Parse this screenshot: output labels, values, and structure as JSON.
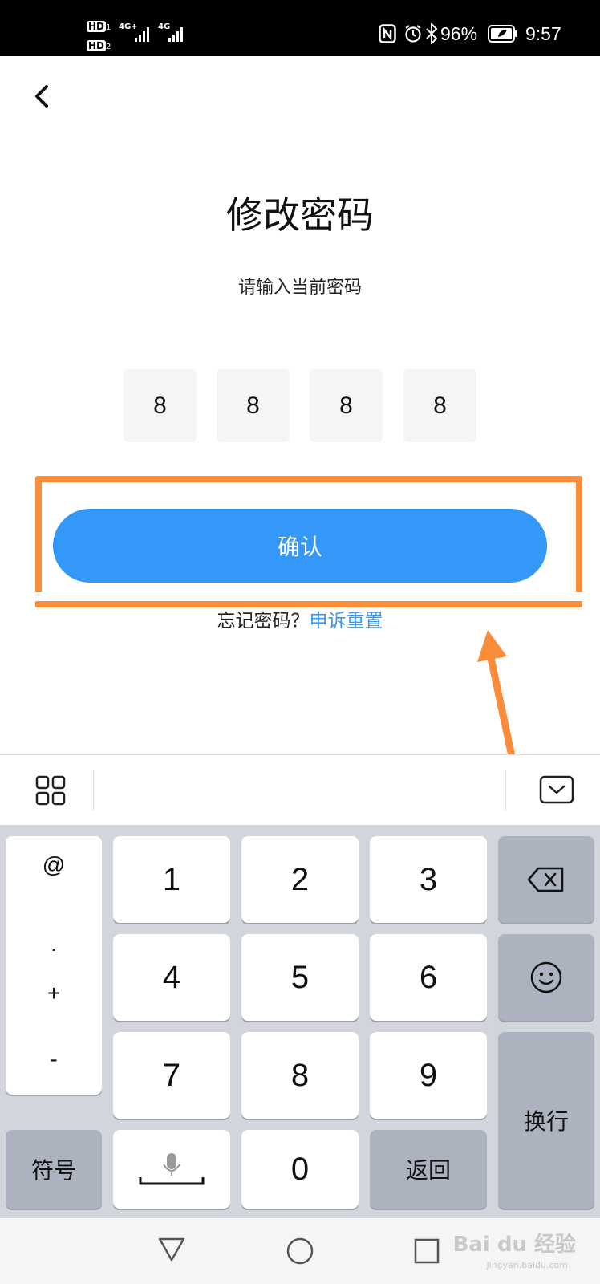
{
  "status_bar": {
    "hd1": "HD",
    "hd1_sub": "1",
    "hd2": "HD",
    "hd2_sub": "2",
    "net1": "4G+",
    "net2": "4G",
    "battery": "96%",
    "time": "9:57",
    "icons": [
      "nfc-icon",
      "alarm-icon",
      "bluetooth-icon",
      "battery-icon"
    ]
  },
  "header": {
    "title": "修改密码",
    "subtitle": "请输入当前密码"
  },
  "pin": {
    "digits": [
      "8",
      "8",
      "8",
      "8"
    ]
  },
  "confirm_button": {
    "label": "确认"
  },
  "forgot": {
    "text": "忘记密码？",
    "link": "申诉重置"
  },
  "keyboard": {
    "symbols": [
      "@",
      ".",
      "+",
      "-"
    ],
    "digits": [
      "1",
      "2",
      "3",
      "4",
      "5",
      "6",
      "7",
      "8",
      "9",
      "0"
    ],
    "symbol_key": "符号",
    "return_key": "返回",
    "enter_key": "换行"
  },
  "watermark": {
    "brand": "Bai du 经验",
    "url": "jingyan.baidu.com"
  },
  "colors": {
    "accent": "#3498f8",
    "highlight": "#fb8c3a",
    "pin_box": "#f5f5f5",
    "keyboard_bg": "#d3d5dd"
  }
}
